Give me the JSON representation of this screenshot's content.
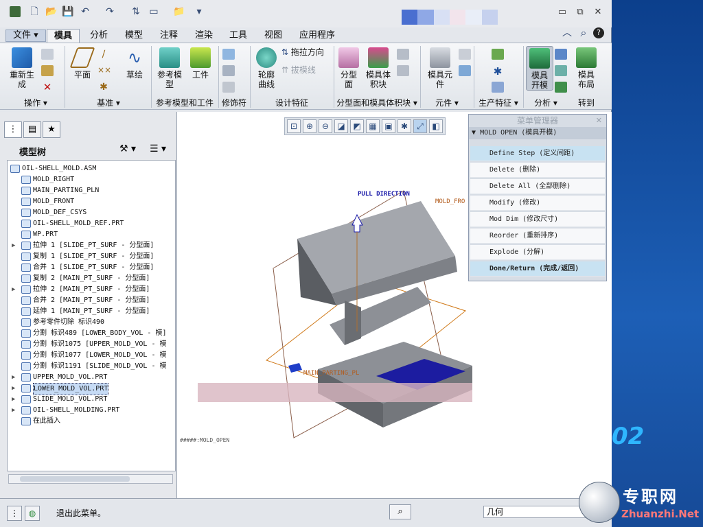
{
  "tabs": {
    "file": "文件",
    "items": [
      "模具",
      "分析",
      "模型",
      "注释",
      "渲染",
      "工具",
      "视图",
      "应用程序"
    ]
  },
  "ribbon": {
    "buttons": {
      "regen": "重新生\n成",
      "plane": "平面",
      "sketch": "草绘",
      "ref_model": "参考模\n型",
      "workpiece": "工件",
      "drag_dir": "拖拉方向",
      "draft_line": "拔模线",
      "contour": "轮廓\n曲线",
      "parting_surf": "分型\n面",
      "mold_vol": "模具体\n积块",
      "mold_comp": "模具元\n件",
      "mold_open": "模具\n开模",
      "mold_layout": "模具\n布局"
    },
    "groups": [
      "操作",
      "基准",
      "参考模型和工件",
      "修饰符",
      "设计特征",
      "分型面和模具体积块",
      "元件",
      "生产特征",
      "分析",
      "转到"
    ]
  },
  "left_panel": {
    "tree_title": "模型树",
    "rows": [
      {
        "text": "OIL-SHELL_MOLD.ASM",
        "indent": 0,
        "expand": ""
      },
      {
        "text": "MOLD_RIGHT",
        "indent": 1,
        "expand": ""
      },
      {
        "text": "MAIN_PARTING_PLN",
        "indent": 1,
        "expand": ""
      },
      {
        "text": "MOLD_FRONT",
        "indent": 1,
        "expand": ""
      },
      {
        "text": "MOLD_DEF_CSYS",
        "indent": 1,
        "expand": ""
      },
      {
        "text": "OIL-SHELL_MOLD_REF.PRT",
        "indent": 1,
        "expand": ""
      },
      {
        "text": "WP.PRT",
        "indent": 1,
        "expand": ""
      },
      {
        "text": "拉伸 1 [SLIDE_PT_SURF - 分型面]",
        "indent": 1,
        "expand": "▶"
      },
      {
        "text": "复制 1 [SLIDE_PT_SURF - 分型面]",
        "indent": 1,
        "expand": ""
      },
      {
        "text": "合并 1 [SLIDE_PT_SURF - 分型面]",
        "indent": 1,
        "expand": ""
      },
      {
        "text": "复制 2 [MAIN_PT_SURF - 分型面]",
        "indent": 1,
        "expand": ""
      },
      {
        "text": "拉伸 2 [MAIN_PT_SURF - 分型面]",
        "indent": 1,
        "expand": "▶"
      },
      {
        "text": "合并 2 [MAIN_PT_SURF - 分型面]",
        "indent": 1,
        "expand": ""
      },
      {
        "text": "延伸 1 [MAIN_PT_SURF - 分型面]",
        "indent": 1,
        "expand": ""
      },
      {
        "text": "参考零件切除 标识490",
        "indent": 1,
        "expand": ""
      },
      {
        "text": "分割 标识489 [LOWER_BODY_VOL - 模]",
        "indent": 1,
        "expand": ""
      },
      {
        "text": "分割 标识1075 [UPPER_MOLD_VOL - 模",
        "indent": 1,
        "expand": ""
      },
      {
        "text": "分割 标识1077 [LOWER_MOLD_VOL - 模",
        "indent": 1,
        "expand": ""
      },
      {
        "text": "分割 标识1191 [SLIDE_MOLD_VOL - 模",
        "indent": 1,
        "expand": ""
      },
      {
        "text": "UPPER_MOLD_VOL.PRT",
        "indent": 1,
        "expand": "▶"
      },
      {
        "text": "LOWER_MOLD_VOL.PRT",
        "indent": 1,
        "expand": "▶",
        "selected": true
      },
      {
        "text": "SLIDE_MOLD_VOL.PRT",
        "indent": 1,
        "expand": "▶"
      },
      {
        "text": "OIL-SHELL_MOLDING.PRT",
        "indent": 1,
        "expand": "▶"
      },
      {
        "text": "在此插入",
        "indent": 1,
        "expand": ""
      }
    ]
  },
  "graphics": {
    "pull_direction": "PULL DIRECTION",
    "mold_front": "MOLD_FRO",
    "main_parting": "MAIN_PARTING_PL",
    "view_name": "#####:MOLD_OPEN"
  },
  "menu_manager": {
    "title": "菜单管理器",
    "header": "MOLD OPEN (模具开模)",
    "items": [
      {
        "label": "Define Step (定义间距)",
        "highlight": true
      },
      {
        "label": "Delete (删除)"
      },
      {
        "label": "Delete All (全部删除)"
      },
      {
        "label": "Modify (修改)"
      },
      {
        "label": "Mod Dim (修改尺寸)"
      },
      {
        "label": "Reorder (重新排序)"
      },
      {
        "label": "Explode (分解)"
      },
      {
        "label": "Done/Return (完成/返回)",
        "highlight": true,
        "bold": true
      }
    ]
  },
  "status": {
    "message": "退出此菜单。",
    "filter": "几何"
  },
  "watermark": {
    "cn": "专职网",
    "en": "Zhuanzhi.Net"
  },
  "desktop": {
    "num": "02"
  }
}
